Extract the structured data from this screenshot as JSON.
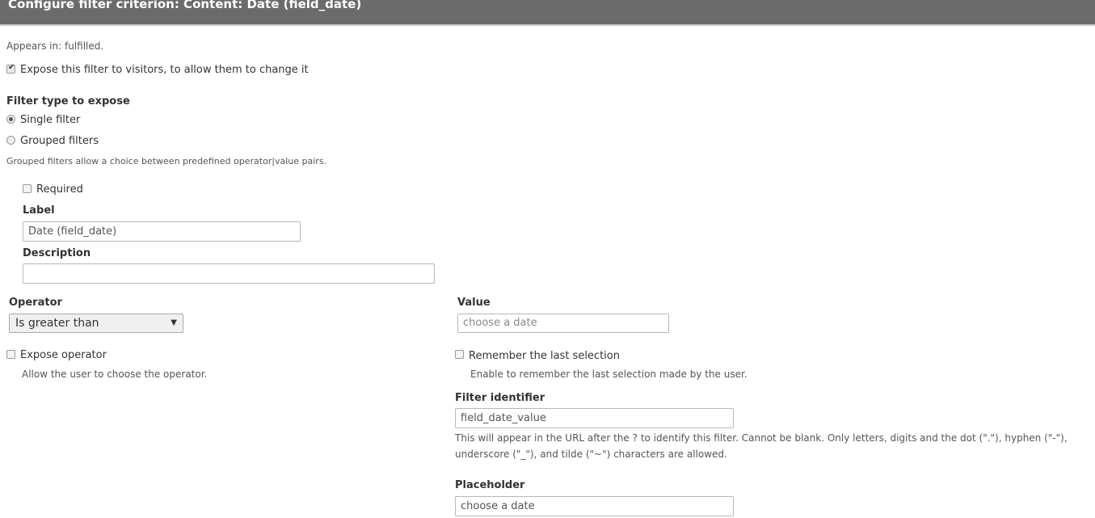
{
  "dialog": {
    "title": "Configure filter criterion: Content: Date (field_date)"
  },
  "appears_in": "Appears in: fulfilled.",
  "expose": {
    "label": "Expose this filter to visitors, to allow them to change it",
    "checked": true
  },
  "filter_type": {
    "heading": "Filter type to expose",
    "options": [
      {
        "label": "Single filter",
        "selected": true
      },
      {
        "label": "Grouped filters",
        "selected": false
      }
    ],
    "help": "Grouped filters allow a choice between predefined operator|value pairs."
  },
  "required": {
    "label": "Required",
    "checked": false
  },
  "label_field": {
    "label": "Label",
    "value": "Date (field_date)"
  },
  "description_field": {
    "label": "Description",
    "value": ""
  },
  "operator": {
    "label": "Operator",
    "value": "Is greater than"
  },
  "expose_operator": {
    "label": "Expose operator",
    "checked": false,
    "help": "Allow the user to choose the operator."
  },
  "value": {
    "label": "Value",
    "placeholder": "choose a date"
  },
  "remember": {
    "label": "Remember the last selection",
    "checked": false,
    "help": "Enable to remember the last selection made by the user."
  },
  "identifier": {
    "label": "Filter identifier",
    "value": "field_date_value",
    "help1": "This will appear in the URL after the ? to identify this filter. Cannot be blank. Only letters, digits and the dot (\".\"), hyphen (\"-\"),",
    "help2": "underscore (\"_\"), and tilde (\"~\") characters are allowed."
  },
  "placeholder": {
    "label": "Placeholder",
    "value": "choose a date"
  }
}
